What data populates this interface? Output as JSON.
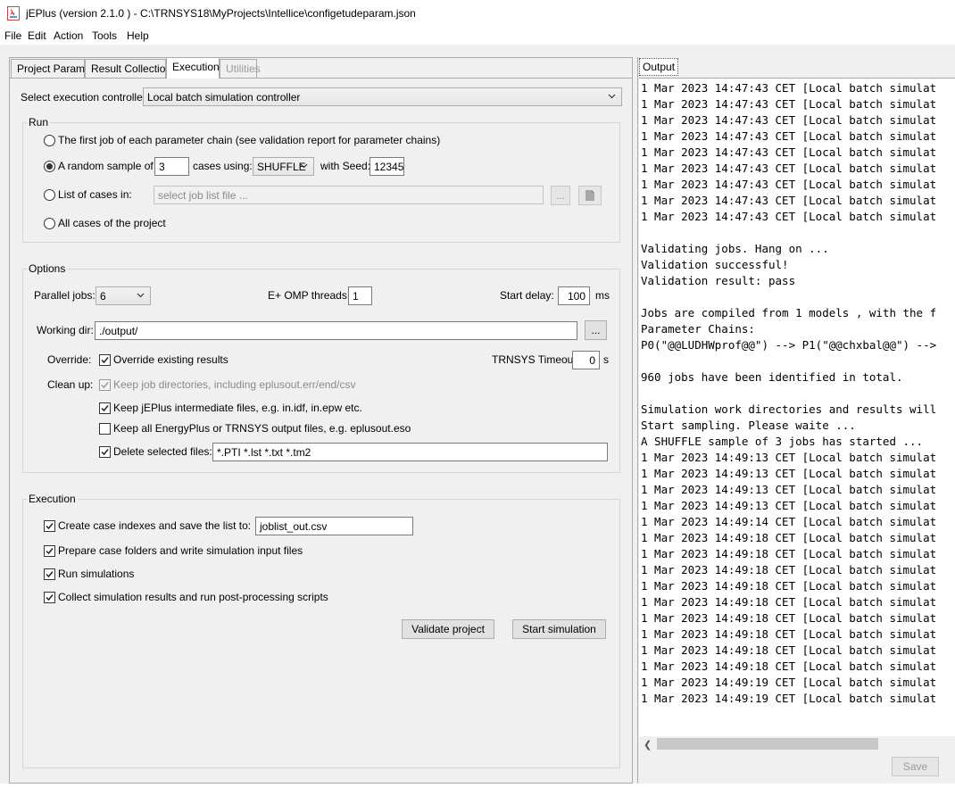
{
  "window": {
    "title": "jEPlus (version 2.1.0 )  - C:\\TRNSYS18\\MyProjects\\Intellice\\configetudeparam.json"
  },
  "menu": [
    "File",
    "Edit",
    "Action",
    "Tools",
    "Help"
  ],
  "tabs": [
    "Project Params",
    "Result Collection",
    "Execution",
    "Utilities"
  ],
  "controller": {
    "label": "Select execution controller:",
    "value": "Local batch simulation controller"
  },
  "run": {
    "title": "Run",
    "first_job": "The first job of each parameter chain (see validation report for parameter chains)",
    "random_prefix": "A random sample of",
    "random_count": "3",
    "cases_using": "cases using:",
    "method": "SHUFFLE",
    "with_seed": "with Seed:",
    "seed": "12345",
    "list_of_cases": "List of cases in:",
    "list_placeholder": "select job list file ...",
    "browse": "...",
    "all_cases": "All cases of the project"
  },
  "options": {
    "title": "Options",
    "parallel_label": "Parallel jobs:",
    "parallel_value": "6",
    "omp_label": "E+ OMP threads:",
    "omp_value": "1",
    "delay_label": "Start delay:",
    "delay_value": "100",
    "delay_unit": "ms",
    "workdir_label": "Working dir:",
    "workdir_value": "./output/",
    "browse": "...",
    "override_label": "Override:",
    "override_check": "Override existing results",
    "trnsys_label": "TRNSYS Timeout:",
    "trnsys_value": "0",
    "trnsys_unit": "s",
    "cleanup_label": "Clean up:",
    "keep_dirs": "Keep job directories, including eplusout.err/end/csv",
    "keep_jeplus": "Keep jEPlus intermediate files, e.g. in.idf, in.epw etc.",
    "keep_all": "Keep all EnergyPlus or TRNSYS output files, e.g. eplusout.eso",
    "delete_selected": "Delete selected files:",
    "delete_value": "*.PTI *.lst *.txt *.tm2"
  },
  "execution": {
    "title": "Execution",
    "create_index": "Create case indexes and save the list to:",
    "joblist": "joblist_out.csv",
    "prepare": "Prepare case folders and write simulation input files",
    "run_sims": "Run simulations",
    "collect": "Collect simulation results and run post-processing scripts",
    "validate_btn": "Validate project",
    "start_btn": "Start simulation"
  },
  "output": {
    "tab": "Output",
    "save_btn": "Save",
    "lines": [
      "1 Mar 2023 14:47:43 CET [Local batch simulat",
      "1 Mar 2023 14:47:43 CET [Local batch simulat",
      "1 Mar 2023 14:47:43 CET [Local batch simulat",
      "1 Mar 2023 14:47:43 CET [Local batch simulat",
      "1 Mar 2023 14:47:43 CET [Local batch simulat",
      "1 Mar 2023 14:47:43 CET [Local batch simulat",
      "1 Mar 2023 14:47:43 CET [Local batch simulat",
      "1 Mar 2023 14:47:43 CET [Local batch simulat",
      "1 Mar 2023 14:47:43 CET [Local batch simulat",
      "",
      "Validating jobs. Hang on ...",
      "Validation successful!",
      "Validation result: pass",
      "",
      "Jobs are compiled from 1 models , with the f",
      "Parameter Chains:",
      "P0(\"@@LUDHWprof@@\") --> P1(\"@@chxbal@@\") -->",
      "",
      "960 jobs have been identified in total.",
      "",
      "Simulation work directories and results will",
      "Start sampling. Please waite ...",
      "A SHUFFLE sample of 3 jobs has started ...",
      "1 Mar 2023 14:49:13 CET [Local batch simulat",
      "1 Mar 2023 14:49:13 CET [Local batch simulat",
      "1 Mar 2023 14:49:13 CET [Local batch simulat",
      "1 Mar 2023 14:49:13 CET [Local batch simulat",
      "1 Mar 2023 14:49:14 CET [Local batch simulat",
      "1 Mar 2023 14:49:18 CET [Local batch simulat",
      "1 Mar 2023 14:49:18 CET [Local batch simulat",
      "1 Mar 2023 14:49:18 CET [Local batch simulat",
      "1 Mar 2023 14:49:18 CET [Local batch simulat",
      "1 Mar 2023 14:49:18 CET [Local batch simulat",
      "1 Mar 2023 14:49:18 CET [Local batch simulat",
      "1 Mar 2023 14:49:18 CET [Local batch simulat",
      "1 Mar 2023 14:49:18 CET [Local batch simulat",
      "1 Mar 2023 14:49:18 CET [Local batch simulat",
      "1 Mar 2023 14:49:19 CET [Local batch simulat",
      "1 Mar 2023 14:49:19 CET [Local batch simulat"
    ]
  }
}
